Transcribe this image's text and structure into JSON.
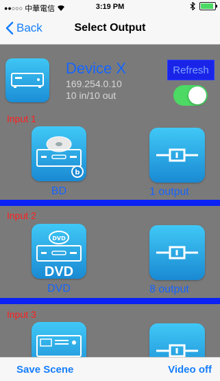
{
  "status": {
    "carrier": "中華電信",
    "time": "3:19 PM"
  },
  "nav": {
    "back_label": "Back",
    "title": "Select Output"
  },
  "device": {
    "name": "Device X",
    "ip": "169.254.0.10",
    "io": "10 in/10 out",
    "refresh_label": "Refresh",
    "power_on": true
  },
  "inputs": [
    {
      "label": "Input 1",
      "source": "BD",
      "output": "1 output"
    },
    {
      "label": "Input 2",
      "source": "DVD",
      "output": "8 output",
      "badge": "DVD"
    },
    {
      "label": "Input 3"
    }
  ],
  "toolbar": {
    "save_label": "Save Scene",
    "video_label": "Video off"
  },
  "colors": {
    "accent": "#157efb",
    "device_text": "#1565ff",
    "input_label": "#ff2020",
    "divider": "#0b22f5",
    "toggle_on": "#4cd964"
  }
}
